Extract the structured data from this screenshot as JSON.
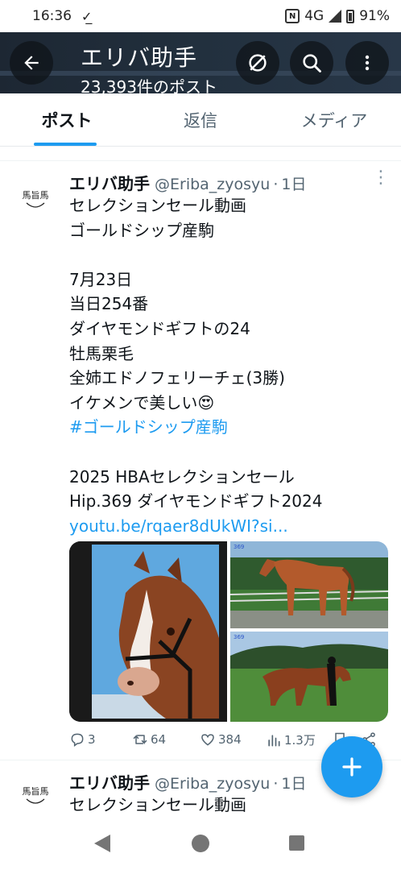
{
  "status_bar": {
    "time": "16:36",
    "download_indicator": "download-done-icon",
    "network": "4G",
    "battery": "91%"
  },
  "header": {
    "title": "エリバ助手",
    "subtitle": "23,393件のポスト",
    "icons": [
      "back-arrow-icon",
      "search-off-icon",
      "search-icon",
      "more-vertical-icon"
    ]
  },
  "tabs": [
    {
      "label": "ポスト",
      "active": true
    },
    {
      "label": "返信",
      "active": false
    },
    {
      "label": "メディア",
      "active": false
    }
  ],
  "tweet": {
    "name": "エリバ助手",
    "handle": "@Eriba_zyosyu",
    "separator": "·",
    "time": "1日",
    "lines": [
      "セレクションセール動画",
      "ゴールドシップ産駒",
      "",
      "7月23日",
      "当日254番",
      "ダイヤモンドギフトの24",
      "牡馬栗毛",
      "全姉エドノフェリーチェ(3勝)",
      "イケメンで美しい😍"
    ],
    "hashtag": "#ゴールドシップ産駒",
    "lines_after": [
      "2025 HBAセレクションセール",
      "Hip.369 ダイヤモンドギフト2024"
    ],
    "link": "youtu.be/rqaer8dUkWI?si...",
    "media": [
      "horse-headshot-photo",
      "horse-standing-photo",
      "horse-walking-photo"
    ],
    "stats": {
      "replies": "3",
      "reposts": "64",
      "likes": "384",
      "views": "1.3万"
    }
  },
  "tweet2": {
    "name": "エリバ助手",
    "handle": "@Eriba_zyosyu",
    "separator": "·",
    "time": "1日",
    "first_line": "セレクションセール動画"
  },
  "colors": {
    "accent": "#1d9bf0",
    "header_bg": "#1d2733",
    "text_secondary": "#536471"
  }
}
